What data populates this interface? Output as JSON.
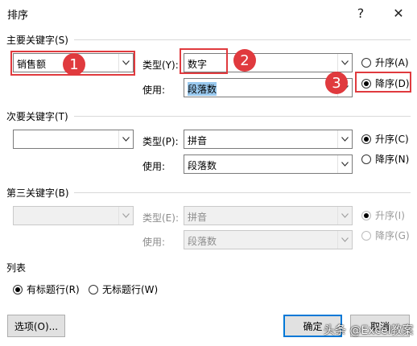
{
  "window": {
    "title": "排序",
    "help_glyph": "?",
    "close_glyph": "✕"
  },
  "primary": {
    "section_label": "主要关键字(S)",
    "key_value": "销售额",
    "type_label": "类型(Y):",
    "type_value": "数字",
    "use_label": "使用:",
    "use_value": "段落数",
    "asc_label": "升序(A)",
    "desc_label": "降序(D)",
    "selected_order": "desc"
  },
  "secondary": {
    "section_label": "次要关键字(T)",
    "key_value": "",
    "type_label": "类型(P):",
    "type_value": "拼音",
    "use_label": "使用:",
    "use_value": "段落数",
    "asc_label": "升序(C)",
    "desc_label": "降序(N)",
    "selected_order": "asc"
  },
  "tertiary": {
    "section_label": "第三关键字(B)",
    "key_value": "",
    "type_label": "类型(E):",
    "type_value": "拼音",
    "use_label": "使用:",
    "use_value": "段落数",
    "asc_label": "升序(I)",
    "desc_label": "降序(G)",
    "selected_order": "asc",
    "enabled": false
  },
  "list": {
    "section_label": "列表",
    "header_row_label": "有标题行(R)",
    "no_header_row_label": "无标题行(W)",
    "selected": "header"
  },
  "buttons": {
    "options": "选项(O)...",
    "ok": "确定",
    "cancel": "取消"
  },
  "annotations": {
    "badge1": "1",
    "badge2": "2",
    "badge3": "3",
    "color": "#e03a3e"
  },
  "watermark": "头条 @Excel教案"
}
